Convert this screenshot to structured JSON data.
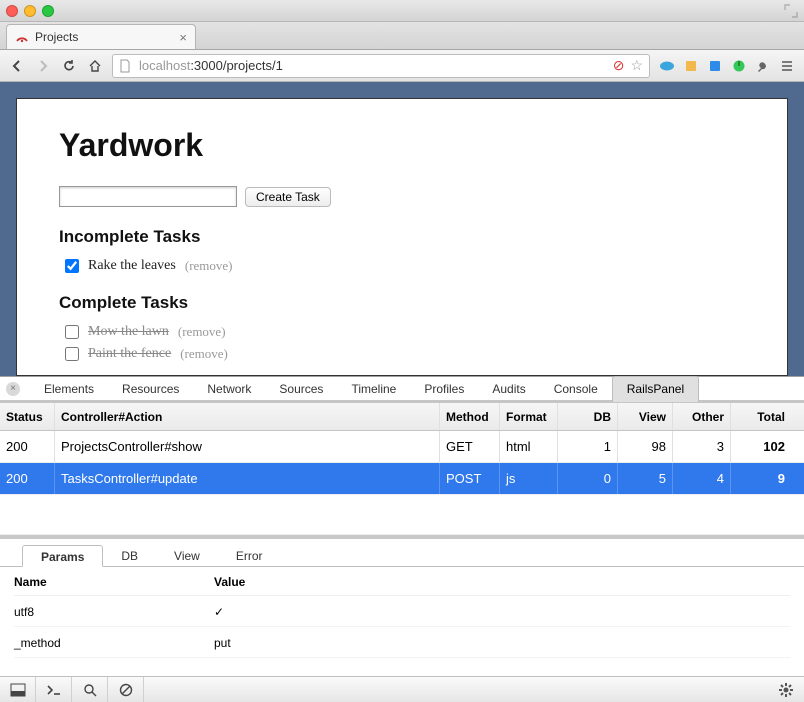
{
  "browser": {
    "tab_title": "Projects",
    "url_muted_prefix": "localhost",
    "url_path": ":3000/projects/1"
  },
  "page": {
    "title": "Yardwork",
    "create_button": "Create Task",
    "incomplete_heading": "Incomplete Tasks",
    "complete_heading": "Complete Tasks",
    "remove_label": "(remove)",
    "incomplete": [
      {
        "text": "Rake the leaves",
        "checked": true
      }
    ],
    "complete": [
      {
        "text": "Mow the lawn",
        "checked": false
      },
      {
        "text": "Paint the fence",
        "checked": false
      }
    ]
  },
  "devtools": {
    "tabs": [
      "Elements",
      "Resources",
      "Network",
      "Sources",
      "Timeline",
      "Profiles",
      "Audits",
      "Console",
      "RailsPanel"
    ],
    "active_tab": "RailsPanel",
    "request_columns": {
      "status": "Status",
      "action": "Controller#Action",
      "method": "Method",
      "format": "Format",
      "db": "DB",
      "view": "View",
      "other": "Other",
      "total": "Total"
    },
    "requests": [
      {
        "status": "200",
        "action": "ProjectsController#show",
        "method": "GET",
        "format": "html",
        "db": "1",
        "view": "98",
        "other": "3",
        "total": "102",
        "selected": false
      },
      {
        "status": "200",
        "action": "TasksController#update",
        "method": "POST",
        "format": "js",
        "db": "0",
        "view": "5",
        "other": "4",
        "total": "9",
        "selected": true
      }
    ],
    "detail_tabs": [
      "Params",
      "DB",
      "View",
      "Error"
    ],
    "detail_active": "Params",
    "detail_columns": {
      "name": "Name",
      "value": "Value"
    },
    "params": [
      {
        "name": "utf8",
        "value": "✓"
      },
      {
        "name": "_method",
        "value": "put"
      }
    ]
  }
}
